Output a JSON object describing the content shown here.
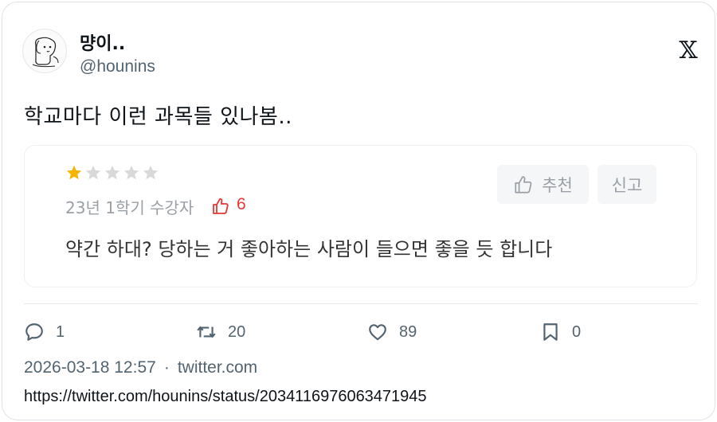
{
  "author": {
    "display_name": "먕이..",
    "handle": "@hounins",
    "avatar_icon": "puppy-drawing-avatar"
  },
  "brand": {
    "logo_icon": "x-logo",
    "logo_glyph": "𝕏"
  },
  "tweet": {
    "text": "학교마다 이런 과목들 있나봄.."
  },
  "quoted_review": {
    "rating": 1,
    "rating_max": 5,
    "semester_label": "23년 1학기 수강자",
    "likes": "6",
    "review_text": "약간 하대? 당하는 거 좋아하는 사람이 들으면 좋을 듯 합니다",
    "recommend_label": "추천",
    "report_label": "신고",
    "colors": {
      "star_filled": "#f5b400",
      "star_empty": "#d9d9d9",
      "like": "#e53935",
      "muted": "#9aa0a6"
    }
  },
  "actions": {
    "replies": "1",
    "retweets": "20",
    "likes": "89",
    "bookmarks": "0"
  },
  "meta": {
    "timestamp": "2026-03-18 12:57",
    "separator": "·",
    "source": "twitter.com",
    "url": "https://twitter.com/hounins/status/2034116976063471945"
  }
}
